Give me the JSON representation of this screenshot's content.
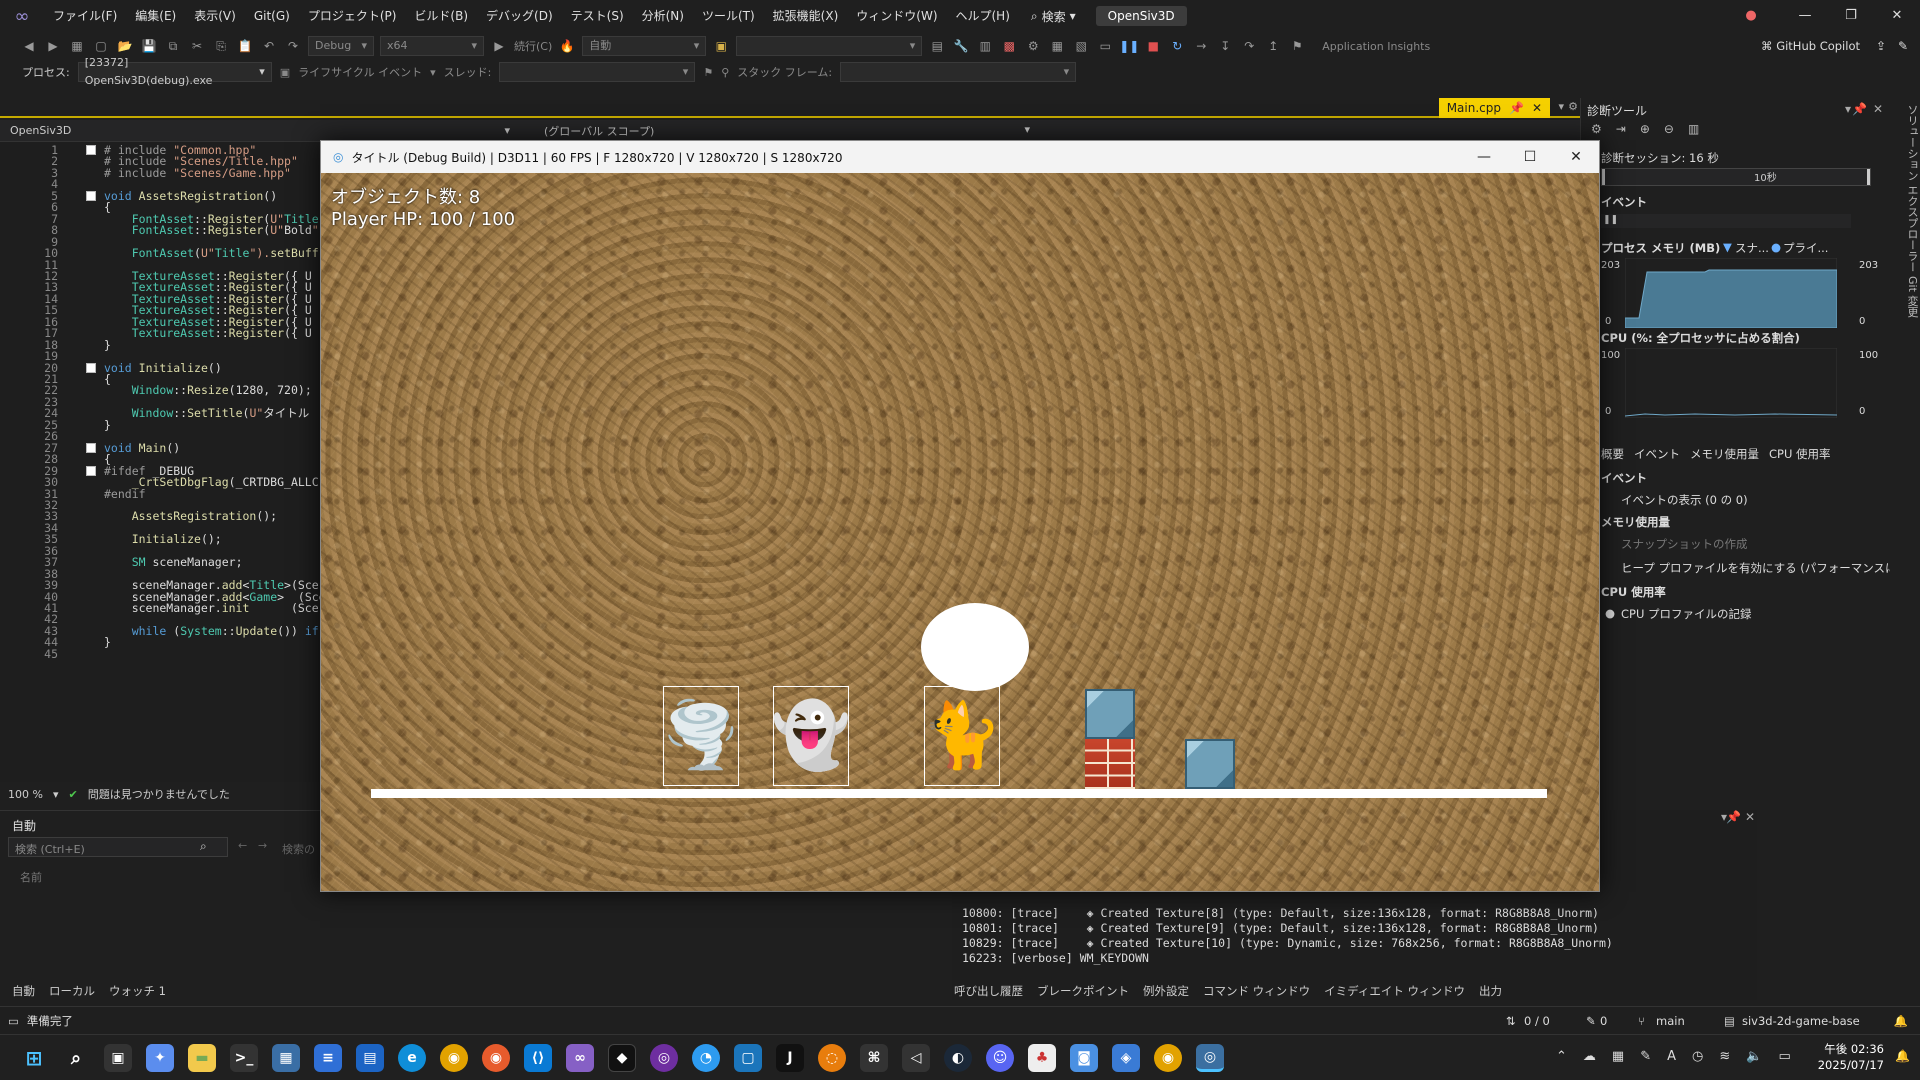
{
  "menubar": {
    "items": [
      "ファイル(F)",
      "編集(E)",
      "表示(V)",
      "Git(G)",
      "プロジェクト(P)",
      "ビルド(B)",
      "デバッグ(D)",
      "テスト(S)",
      "分析(N)",
      "ツール(T)",
      "拡張機能(X)",
      "ウィンドウ(W)",
      "ヘルプ(H)"
    ],
    "search_label": "検索",
    "solution_name": "OpenSiv3D"
  },
  "toolbar": {
    "config": "Debug",
    "platform": "x64",
    "continue_label": "続行(C)",
    "auto_label": "自動",
    "insights_label": "Application Insights",
    "copilot_label": "GitHub Copilot"
  },
  "toolbar2": {
    "process_label": "プロセス:",
    "process_value": "[23372] OpenSiv3D(debug).exe",
    "lifecycle_label": "ライフサイクル イベント",
    "thread_label": "スレッド:",
    "stackframe_label": "スタック フレーム:"
  },
  "tabs": {
    "main_tab": "Main.cpp"
  },
  "navrow": {
    "project": "OpenSiv3D",
    "scope": "(グローバル スコープ)"
  },
  "editor": {
    "lines": [
      {
        "n": "1",
        "t": "# include \"Common.hpp\""
      },
      {
        "n": "2",
        "t": "# include \"Scenes/Title.hpp\""
      },
      {
        "n": "3",
        "t": "# include \"Scenes/Game.hpp\""
      },
      {
        "n": "4",
        "t": ""
      },
      {
        "n": "5",
        "t": "void AssetsRegistration()"
      },
      {
        "n": "6",
        "t": "{"
      },
      {
        "n": "7",
        "t": "    FontAsset::Register(U\"Title"
      },
      {
        "n": "8",
        "t": "    FontAsset::Register(U\"Bold\""
      },
      {
        "n": "9",
        "t": ""
      },
      {
        "n": "10",
        "t": "    FontAsset(U\"Title\").setBuff"
      },
      {
        "n": "11",
        "t": ""
      },
      {
        "n": "12",
        "t": "    TextureAsset::Register({ U"
      },
      {
        "n": "13",
        "t": "    TextureAsset::Register({ U"
      },
      {
        "n": "14",
        "t": "    TextureAsset::Register({ U"
      },
      {
        "n": "15",
        "t": "    TextureAsset::Register({ U"
      },
      {
        "n": "16",
        "t": "    TextureAsset::Register({ U"
      },
      {
        "n": "17",
        "t": "    TextureAsset::Register({ U"
      },
      {
        "n": "18",
        "t": "}"
      },
      {
        "n": "19",
        "t": ""
      },
      {
        "n": "20",
        "t": "void Initialize()"
      },
      {
        "n": "21",
        "t": "{"
      },
      {
        "n": "22",
        "t": "    Window::Resize(1280, 720);"
      },
      {
        "n": "23",
        "t": ""
      },
      {
        "n": "24",
        "t": "    Window::SetTitle(U\"タイトル"
      },
      {
        "n": "25",
        "t": "}"
      },
      {
        "n": "26",
        "t": ""
      },
      {
        "n": "27",
        "t": "void Main()"
      },
      {
        "n": "28",
        "t": "{"
      },
      {
        "n": "29",
        "t": "#ifdef _DEBUG"
      },
      {
        "n": "30",
        "t": "    _CrtSetDbgFlag(_CRTDBG_ALLC"
      },
      {
        "n": "31",
        "t": "#endif"
      },
      {
        "n": "32",
        "t": ""
      },
      {
        "n": "33",
        "t": "    AssetsRegistration();"
      },
      {
        "n": "34",
        "t": ""
      },
      {
        "n": "35",
        "t": "    Initialize();"
      },
      {
        "n": "36",
        "t": ""
      },
      {
        "n": "37",
        "t": "    SM sceneManager;"
      },
      {
        "n": "38",
        "t": ""
      },
      {
        "n": "39",
        "t": "    sceneManager.add<Title>(Sce"
      },
      {
        "n": "40",
        "t": "    sceneManager.add<Game>  (Sce"
      },
      {
        "n": "41",
        "t": "    sceneManager.init      (Sce"
      },
      {
        "n": "42",
        "t": ""
      },
      {
        "n": "43",
        "t": "    while (System::Update()) if"
      },
      {
        "n": "44",
        "t": "}"
      },
      {
        "n": "45",
        "t": ""
      }
    ],
    "zoom": "100 %",
    "status": "問題は見つかりませんでした"
  },
  "autos": {
    "title": "自動",
    "search_placeholder": "検索 (Ctrl+E)",
    "search_depth": "検索の",
    "col_name": "名前",
    "tabs": [
      "自動",
      "ローカル",
      "ウォッチ 1"
    ]
  },
  "output": {
    "lines": [
      "10800: [trace]    ◈ Created Texture[8] (type: Default, size:136x128, format: R8G8B8A8_Unorm)",
      "10801: [trace]    ◈ Created Texture[9] (type: Default, size:136x128, format: R8G8B8A8_Unorm)",
      "10829: [trace]    ◈ Created Texture[10] (type: Dynamic, size: 768x256, format: R8G8B8A8_Unorm)",
      "16223: [verbose] WM_KEYDOWN"
    ],
    "tabs": [
      "呼び出し履歴",
      "ブレークポイント",
      "例外設定",
      "コマンド ウィンドウ",
      "イミディエイト ウィンドウ",
      "出力"
    ]
  },
  "diag": {
    "title": "診断ツール",
    "session": "診断セッション: 16 秒",
    "timeline_label": "10秒",
    "events_header": "イベント",
    "memory_header": "プロセス メモリ (MB)",
    "memory_legend_1": "スナ...",
    "memory_legend_2": "プライ...",
    "memory_max": "203",
    "memory_min": "0",
    "memory_left_max": "203",
    "memory_left_min": "0",
    "cpu_header": "CPU (%: 全プロセッサに占める割合)",
    "cpu_max": "100",
    "cpu_min": "0",
    "cpu_left_max": "100",
    "cpu_left_min": "0",
    "tabs": [
      "概要",
      "イベント",
      "メモリ使用量",
      "CPU 使用率"
    ],
    "sec_events": "イベント",
    "show_events": "イベントの表示 (0 の 0)",
    "sec_memory": "メモリ使用量",
    "take_snapshot": "スナップショットの作成",
    "heap_profile": "ヒープ プロファイルを有効にする (パフォーマンスに影響します)",
    "sec_cpu": "CPU 使用率",
    "record_cpu": "CPU プロファイルの記録"
  },
  "side_rail": "ソリューション エクスプローラー   Git 変更",
  "statusbar": {
    "ready": "準備完了",
    "lines": "0 / 0",
    "pencil": "0",
    "branch": "main",
    "repo": "siv3d-2d-game-base"
  },
  "taskbar": {
    "time": "午後 02:36",
    "date": "2025/07/17"
  },
  "game": {
    "window_title": "タイトル (Debug Build) | D3D11 | 60 FPS | F 1280x720 | V 1280x720 | S 1280x720",
    "hud_objects": "オブジェクト数: 8",
    "hud_hp": "Player HP: 100 / 100",
    "sprites": [
      {
        "name": "tornado-sprite",
        "emoji": "🌪️"
      },
      {
        "name": "ghost-sprite",
        "emoji": "👻"
      },
      {
        "name": "cat-sprite",
        "emoji": "🐈"
      }
    ]
  },
  "colors": {
    "accent_tab": "#f5d000",
    "editor_bg": "#1e1e1e",
    "ground": "#ffffff",
    "ice_block": "#6fa0b8",
    "brick": "#c8452c"
  }
}
